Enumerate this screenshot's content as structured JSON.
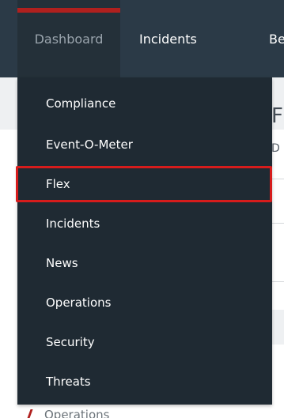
{
  "nav": {
    "items": [
      {
        "label": "Dashboard"
      },
      {
        "label": "Incidents"
      },
      {
        "label": "Be"
      }
    ]
  },
  "dropdown": {
    "items": [
      {
        "label": "Compliance"
      },
      {
        "label": "Event-O-Meter"
      },
      {
        "label": "Flex"
      },
      {
        "label": "Incidents"
      },
      {
        "label": "News"
      },
      {
        "label": "Operations"
      },
      {
        "label": "Security"
      },
      {
        "label": "Threats"
      }
    ],
    "highlighted_label": "Flex"
  },
  "page": {
    "title_fragment": "F",
    "subtitle_fragment": "D",
    "underlying_item": "Operations"
  },
  "colors": {
    "nav_bg": "#2b3a47",
    "dropdown_bg": "#1f2a33",
    "accent": "#b0201e",
    "highlight_border": "#d61c1c"
  }
}
